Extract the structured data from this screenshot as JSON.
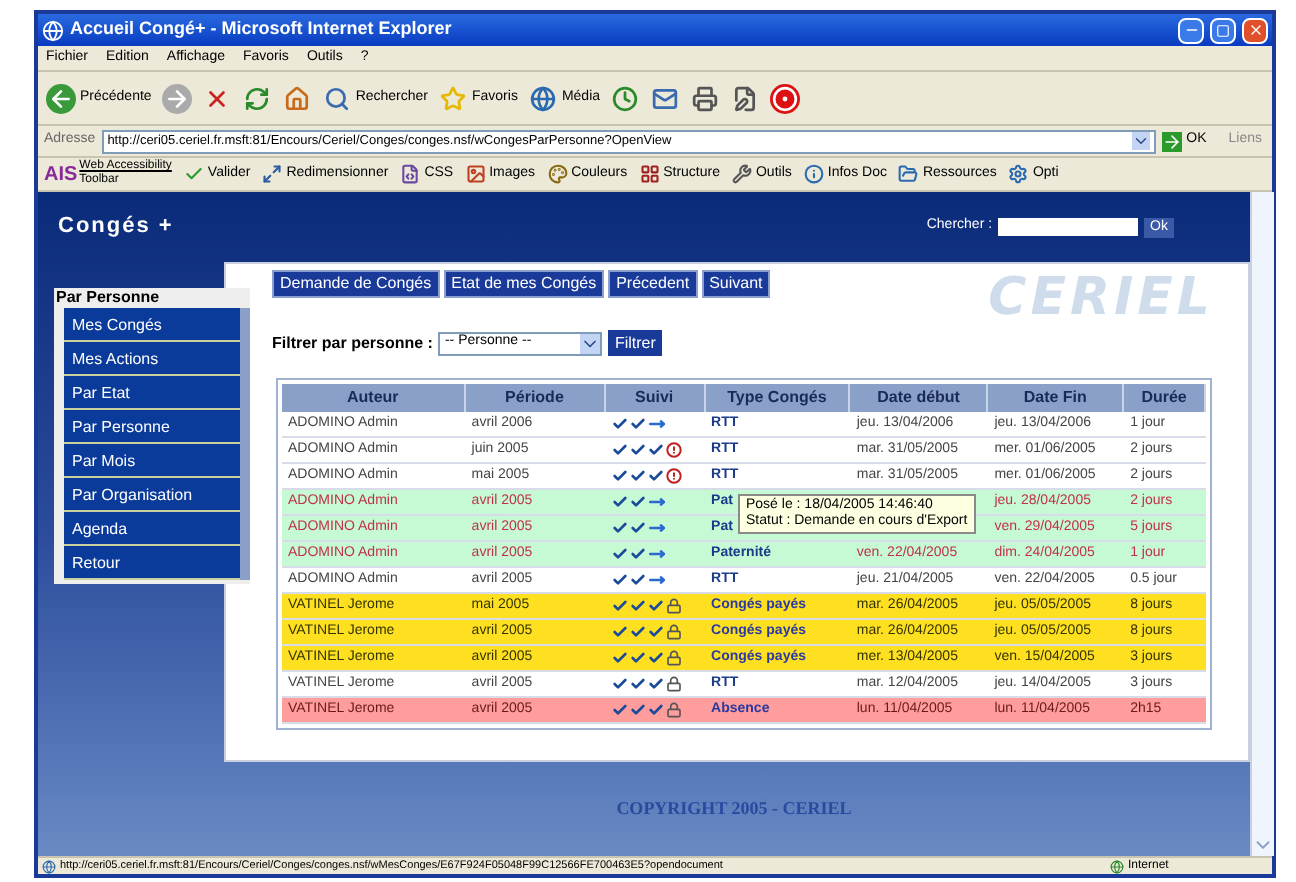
{
  "window": {
    "title": "Accueil Congé+ - Microsoft Internet Explorer"
  },
  "menu_bar": [
    "Fichier",
    "Edition",
    "Affichage",
    "Favoris",
    "Outils",
    "?"
  ],
  "toolbar": [
    {
      "kind": "back",
      "label": "Précédente"
    },
    {
      "kind": "forward"
    },
    {
      "kind": "stop"
    },
    {
      "kind": "refresh"
    },
    {
      "kind": "home"
    },
    {
      "kind": "search",
      "label": "Rechercher"
    },
    {
      "kind": "favorites",
      "label": "Favoris"
    },
    {
      "kind": "media",
      "label": "Média"
    },
    {
      "kind": "history"
    },
    {
      "kind": "mail"
    },
    {
      "kind": "print"
    },
    {
      "kind": "edit"
    },
    {
      "kind": "messenger"
    }
  ],
  "address_bar": {
    "label": "Adresse",
    "value": "http://ceri05.ceriel.fr.msft:81/Encours/Ceriel/Conges/conges.nsf/wCongesParPersonne?OpenView",
    "go": "OK",
    "links": "Liens"
  },
  "accessibility_toolbar": {
    "logo": "AIS",
    "title_1": "Web Accessibility",
    "title_2": "Toolbar",
    "items": [
      {
        "kind": "check",
        "label": "Valider"
      },
      {
        "kind": "resize",
        "label": "Redimensionner"
      },
      {
        "kind": "css",
        "label": "CSS"
      },
      {
        "kind": "images",
        "label": "Images"
      },
      {
        "kind": "colors",
        "label": "Couleurs"
      },
      {
        "kind": "structure",
        "label": "Structure"
      },
      {
        "kind": "tools",
        "label": "Outils"
      },
      {
        "kind": "info",
        "label": "Infos Doc"
      },
      {
        "kind": "resources",
        "label": "Ressources"
      },
      {
        "kind": "options",
        "label": "Opti"
      }
    ]
  },
  "page": {
    "app_title": "Congés +",
    "search": {
      "label": "Chercher :",
      "button": "Ok"
    },
    "sidebar": {
      "heading": "Par Personne",
      "items": [
        "Mes Congés",
        "Mes Actions",
        "Par Etat",
        "Par Personne",
        "Par Mois",
        "Par Organisation",
        "Agenda",
        "Retour"
      ]
    },
    "actions": [
      "Demande de Congés",
      "Etat de mes Congés",
      "Précedent",
      "Suivant"
    ],
    "logo": "CERIEL",
    "filter": {
      "label": "Filtrer par personne :",
      "select": "-- Personne --",
      "button": "Filtrer"
    },
    "table": {
      "columns": [
        "Auteur",
        "Période",
        "Suivi",
        "Type Congés",
        "Date début",
        "Date Fin",
        "Durée"
      ],
      "rows": [
        {
          "kind": "normal",
          "auteur": "ADOMINO Admin",
          "periode": "avril 2006",
          "suivi": [
            {
              "kind": "check"
            },
            {
              "kind": "check"
            },
            {
              "kind": "arrow"
            }
          ],
          "type": "RTT",
          "debut": "jeu. 13/04/2006",
          "fin": "jeu. 13/04/2006",
          "duree": "1 jour"
        },
        {
          "kind": "normal",
          "auteur": "ADOMINO Admin",
          "periode": "juin 2005",
          "suivi": [
            {
              "kind": "check"
            },
            {
              "kind": "check"
            },
            {
              "kind": "check"
            },
            {
              "kind": "alert"
            }
          ],
          "type": "RTT",
          "debut": "mar. 31/05/2005",
          "fin": "mer. 01/06/2005",
          "duree": "2 jours"
        },
        {
          "kind": "normal",
          "auteur": "ADOMINO Admin",
          "periode": "mai 2005",
          "suivi": [
            {
              "kind": "check"
            },
            {
              "kind": "check"
            },
            {
              "kind": "check"
            },
            {
              "kind": "alert"
            }
          ],
          "type": "RTT",
          "debut": "mar. 31/05/2005",
          "fin": "mer. 01/06/2005",
          "duree": "2 jours"
        },
        {
          "kind": "pending",
          "auteur": "ADOMINO Admin",
          "periode": "avril 2005",
          "suivi": [
            {
              "kind": "check"
            },
            {
              "kind": "check"
            },
            {
              "kind": "arrow"
            }
          ],
          "type": "Pat",
          "fin": "jeu. 28/04/2005",
          "duree": "2 jours"
        },
        {
          "kind": "pending",
          "auteur": "ADOMINO Admin",
          "periode": "avril 2005",
          "suivi": [
            {
              "kind": "check"
            },
            {
              "kind": "check"
            },
            {
              "kind": "arrow"
            }
          ],
          "type": "Pat",
          "fin": "ven. 29/04/2005",
          "duree": "5 jours"
        },
        {
          "kind": "pending",
          "auteur": "ADOMINO Admin",
          "periode": "avril 2005",
          "suivi": [
            {
              "kind": "check"
            },
            {
              "kind": "check"
            },
            {
              "kind": "arrow"
            }
          ],
          "type": "Paternité",
          "debut": "ven. 22/04/2005",
          "fin": "dim. 24/04/2005",
          "duree": "1 jour"
        },
        {
          "kind": "normal",
          "auteur": "ADOMINO Admin",
          "periode": "avril 2005",
          "suivi": [
            {
              "kind": "check"
            },
            {
              "kind": "check"
            },
            {
              "kind": "arrow"
            }
          ],
          "type": "RTT",
          "debut": "jeu. 21/04/2005",
          "fin": "ven. 22/04/2005",
          "duree": "0.5 jour"
        },
        {
          "kind": "paid",
          "auteur": "VATINEL Jerome",
          "periode": "mai 2005",
          "suivi": [
            {
              "kind": "check"
            },
            {
              "kind": "check"
            },
            {
              "kind": "check"
            },
            {
              "kind": "lock"
            }
          ],
          "type": "Congés payés",
          "debut": "mar. 26/04/2005",
          "fin": "jeu. 05/05/2005",
          "duree": "8 jours"
        },
        {
          "kind": "paid",
          "auteur": "VATINEL Jerome",
          "periode": "avril 2005",
          "suivi": [
            {
              "kind": "check"
            },
            {
              "kind": "check"
            },
            {
              "kind": "check"
            },
            {
              "kind": "lock"
            }
          ],
          "type": "Congés payés",
          "debut": "mar. 26/04/2005",
          "fin": "jeu. 05/05/2005",
          "duree": "8 jours"
        },
        {
          "kind": "paid",
          "auteur": "VATINEL Jerome",
          "periode": "avril 2005",
          "suivi": [
            {
              "kind": "check"
            },
            {
              "kind": "check"
            },
            {
              "kind": "check"
            },
            {
              "kind": "lock"
            }
          ],
          "type": "Congés payés",
          "debut": "mer. 13/04/2005",
          "fin": "ven. 15/04/2005",
          "duree": "3 jours"
        },
        {
          "kind": "normal",
          "auteur": "VATINEL Jerome",
          "periode": "avril 2005",
          "suivi": [
            {
              "kind": "check"
            },
            {
              "kind": "check"
            },
            {
              "kind": "check"
            },
            {
              "kind": "lock"
            }
          ],
          "type": "RTT",
          "debut": "mar. 12/04/2005",
          "fin": "jeu. 14/04/2005",
          "duree": "3 jours"
        },
        {
          "kind": "rejected",
          "auteur": "VATINEL Jerome",
          "periode": "avril 2005",
          "suivi": [
            {
              "kind": "check"
            },
            {
              "kind": "check"
            },
            {
              "kind": "check"
            },
            {
              "kind": "lock"
            }
          ],
          "type": "Absence",
          "debut": "lun. 11/04/2005",
          "fin": "lun. 11/04/2005",
          "duree": "2h15"
        }
      ]
    },
    "tooltip": [
      "Posé le : 18/04/2005 14:46:40",
      "Statut : Demande en cours d'Export"
    ],
    "copyright": "COPYRIGHT 2005 - CERIEL"
  },
  "status_bar": {
    "url": "http://ceri05.ceriel.fr.msft:81/Encours/Ceriel/Conges/conges.nsf/wMesConges/E67F924F05048F99C12566FE700463E5?opendocument",
    "zone": "Internet"
  }
}
